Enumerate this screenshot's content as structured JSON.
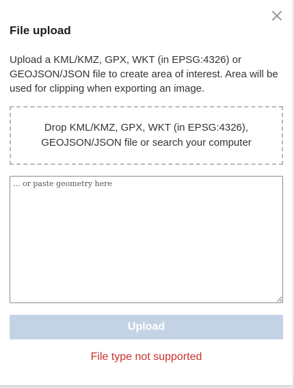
{
  "modal": {
    "title": "File upload",
    "description": "Upload a KML/KMZ, GPX, WKT (in EPSG:4326) or GEOJSON/JSON file to create area of interest. Area will be used for clipping when exporting an image.",
    "close_icon": "close-icon"
  },
  "dropzone": {
    "text": "Drop KML/KMZ, GPX, WKT (in EPSG:4326), GEOJSON/JSON file or search your computer"
  },
  "geometry_input": {
    "value": "",
    "placeholder": "... or paste geometry here"
  },
  "upload_button": {
    "label": "Upload",
    "disabled": true
  },
  "error": {
    "message": "File type not supported",
    "color": "#c9302c"
  },
  "colors": {
    "upload_disabled_bg": "#c3d3e5",
    "dropzone_border": "#b9b9b9"
  }
}
